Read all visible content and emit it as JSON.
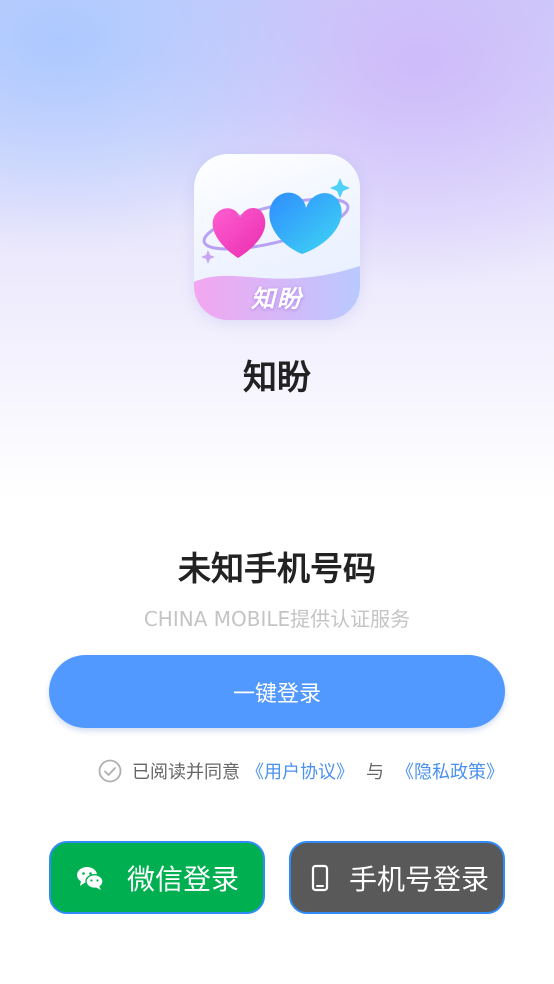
{
  "app": {
    "logo_text": "知盼",
    "name": "知盼"
  },
  "login": {
    "phone_number": "未知手机号码",
    "carrier_note": "CHINA MOBILE提供认证服务",
    "one_click_label": "一键登录"
  },
  "agreement": {
    "prefix": "已阅读并同意",
    "user_agreement": "《用户协议》",
    "conjunction": "与",
    "privacy_policy": "《隐私政策》",
    "checked": false
  },
  "alt_login": {
    "wechat_label": "微信登录",
    "phone_label": "手机号登录"
  },
  "colors": {
    "primary_button": "#5199fe",
    "wechat_button": "#00b050",
    "phone_button": "#595959",
    "link": "#4b91ee"
  },
  "icons": {
    "wechat": "wechat-icon",
    "phone": "mobile-phone-icon",
    "checkbox": "check-circle-icon"
  }
}
